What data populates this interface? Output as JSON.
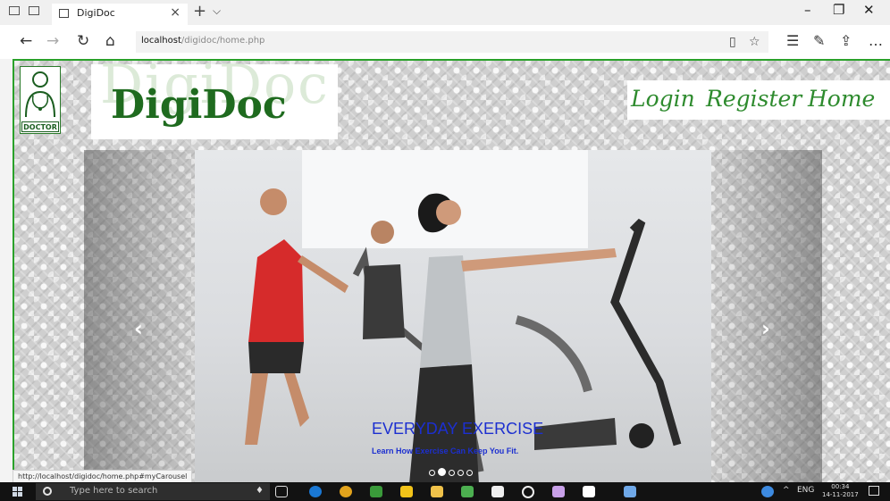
{
  "browser": {
    "tab_title": "DigiDoc",
    "close_glyph": "×",
    "newtab_glyph": "+",
    "tabmenu_glyph": "⌵",
    "address_host": "localhost",
    "address_path": "/digidoc/home.php",
    "status_url": "http://localhost/digidoc/home.php#myCarousel"
  },
  "page": {
    "logo_text": "DigiDoc",
    "logo_ghost": "DigiDoc",
    "logo_badge": "DOCTOR",
    "nav": {
      "login": "Login",
      "register": "Register",
      "home": "Home"
    },
    "carousel": {
      "caption_title": "EVERYDAY EXERCISE",
      "caption_subtitle": "Learn How Exercise Can Keep You Fit.",
      "slide_count": 5,
      "active_index": 1,
      "prev_glyph": "‹",
      "next_glyph": "›"
    }
  },
  "taskbar": {
    "search_placeholder": "Type here to search",
    "language": "ENG",
    "time": "00:34",
    "date": "14-11-2017"
  },
  "icons": {
    "window_controls": [
      "minimize-icon",
      "maximize-icon",
      "close-icon"
    ],
    "toolbar": [
      "reading-view-icon",
      "favorite-star-icon",
      "favorites-hub-icon",
      "pen-icon",
      "share-icon",
      "more-icon"
    ]
  }
}
